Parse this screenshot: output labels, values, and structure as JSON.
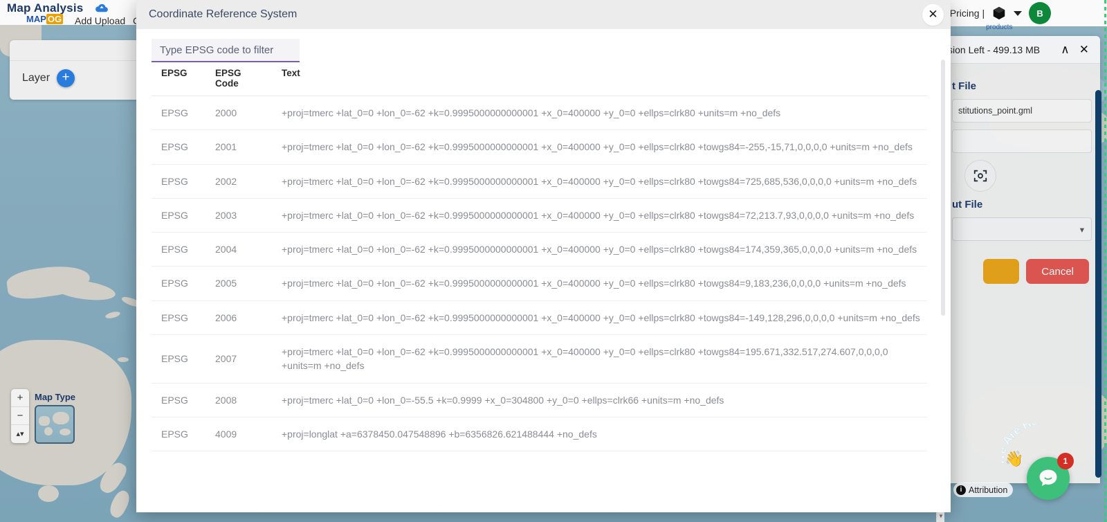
{
  "app": {
    "brand_title": "Map Analysis",
    "brand_logo_main": "MAP",
    "brand_logo_accent": "OG",
    "nav_add_upload": "Add Upload",
    "nav_partial": "C",
    "layer_label": "Layer",
    "plus_icon": "+",
    "map_type_label": "Map Type",
    "zoom_in": "+",
    "zoom_out": "−",
    "compass": "▴▾"
  },
  "right_header": {
    "pricing": "Q  Pricing |",
    "products_label": "products",
    "avatar_initial": "B"
  },
  "tool_panel": {
    "title": "sion Left - 499.13 MB",
    "collapse_icon": "∧",
    "close_icon": "✕",
    "input_section": "t File",
    "input_file_name": "stitutions_point.gml",
    "input_file_empty": "",
    "output_section": "ut File",
    "select_caret": "▾",
    "run_label": "",
    "cancel_label": "Cancel"
  },
  "map_overlay": {
    "attribution": "Attribution",
    "attribution_icon": "i",
    "chat_text": "We Are Here!",
    "chat_badge": "1",
    "hand_icon": "👋"
  },
  "modal": {
    "title": "Coordinate Reference System",
    "close_icon": "✕",
    "filter_placeholder": "Type EPSG code to filter",
    "filter_value": "",
    "columns": [
      "EPSG",
      "EPSG Code",
      "Text"
    ],
    "rows": [
      {
        "epsg": "EPSG",
        "code": "2000",
        "text": "+proj=tmerc +lat_0=0 +lon_0=-62 +k=0.9995000000000001 +x_0=400000 +y_0=0 +ellps=clrk80 +units=m +no_defs"
      },
      {
        "epsg": "EPSG",
        "code": "2001",
        "text": "+proj=tmerc +lat_0=0 +lon_0=-62 +k=0.9995000000000001 +x_0=400000 +y_0=0 +ellps=clrk80 +towgs84=-255,-15,71,0,0,0,0 +units=m +no_defs"
      },
      {
        "epsg": "EPSG",
        "code": "2002",
        "text": "+proj=tmerc +lat_0=0 +lon_0=-62 +k=0.9995000000000001 +x_0=400000 +y_0=0 +ellps=clrk80 +towgs84=725,685,536,0,0,0,0 +units=m +no_defs"
      },
      {
        "epsg": "EPSG",
        "code": "2003",
        "text": "+proj=tmerc +lat_0=0 +lon_0=-62 +k=0.9995000000000001 +x_0=400000 +y_0=0 +ellps=clrk80 +towgs84=72,213.7,93,0,0,0,0 +units=m +no_defs"
      },
      {
        "epsg": "EPSG",
        "code": "2004",
        "text": "+proj=tmerc +lat_0=0 +lon_0=-62 +k=0.9995000000000001 +x_0=400000 +y_0=0 +ellps=clrk80 +towgs84=174,359,365,0,0,0,0 +units=m +no_defs"
      },
      {
        "epsg": "EPSG",
        "code": "2005",
        "text": "+proj=tmerc +lat_0=0 +lon_0=-62 +k=0.9995000000000001 +x_0=400000 +y_0=0 +ellps=clrk80 +towgs84=9,183,236,0,0,0,0 +units=m +no_defs"
      },
      {
        "epsg": "EPSG",
        "code": "2006",
        "text": "+proj=tmerc +lat_0=0 +lon_0=-62 +k=0.9995000000000001 +x_0=400000 +y_0=0 +ellps=clrk80 +towgs84=-149,128,296,0,0,0,0 +units=m +no_defs"
      },
      {
        "epsg": "EPSG",
        "code": "2007",
        "text": "+proj=tmerc +lat_0=0 +lon_0=-62 +k=0.9995000000000001 +x_0=400000 +y_0=0 +ellps=clrk80 +towgs84=195.671,332.517,274.607,0,0,0,0 +units=m +no_defs"
      },
      {
        "epsg": "EPSG",
        "code": "2008",
        "text": "+proj=tmerc +lat_0=0 +lon_0=-55.5 +k=0.9999 +x_0=304800 +y_0=0 +ellps=clrk66 +units=m +no_defs"
      },
      {
        "epsg": "EPSG",
        "code": "4009",
        "text": "+proj=longlat +a=6378450.047548896 +b=6356826.621488444 +no_defs"
      }
    ]
  },
  "colors": {
    "accent_purple": "#7b5ea7",
    "brand_blue": "#1c3a6b",
    "cancel_red": "#e2554e",
    "run_orange": "#e8a317",
    "avatar_green": "#0e8a3c",
    "chat_green": "#3fc47c",
    "badge_red": "#d93025",
    "scrollbar_navy": "#10416b"
  }
}
